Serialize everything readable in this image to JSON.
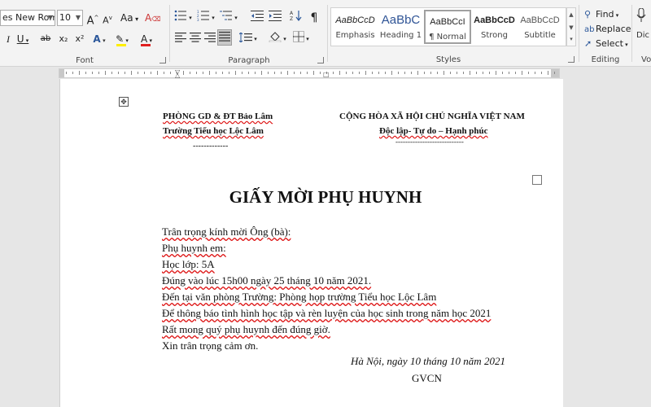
{
  "ribbon": {
    "font": {
      "label": "Font",
      "font_name": "es New Roma",
      "font_size": "10",
      "grow_label": "A",
      "shrink_label": "A",
      "case_label": "Aa",
      "clear_label": "A",
      "italic_label": "I",
      "underline_label": "U",
      "strike_label": "ab",
      "subscript_label": "x₂",
      "superscript_label": "x²",
      "effects_label": "A",
      "highlight_label": "✎",
      "color_label": "A",
      "color_accent": "#e02020",
      "highlight_accent": "#ffee00"
    },
    "paragraph": {
      "label": "Paragraph",
      "pilcrow": "¶"
    },
    "styles": {
      "label": "Styles",
      "items": [
        {
          "preview": "AaBbCcD",
          "name": "Emphasis"
        },
        {
          "preview": "AaBbC",
          "name": "Heading 1"
        },
        {
          "preview": "AaBbCcI",
          "name": "¶ Normal"
        },
        {
          "preview": "AaBbCcD",
          "name": "Strong"
        },
        {
          "preview": "AaBbCcD",
          "name": "Subtitle"
        }
      ],
      "heading_color": "#2f5496"
    },
    "editing": {
      "label": "Editing",
      "find": "Find",
      "replace": "Replace",
      "select": "Select"
    },
    "cut_off": {
      "dictate": "Dic",
      "voice": "Vo"
    }
  },
  "document": {
    "header_left_1": "PHÒNG GD & ĐT Bảo Lâm",
    "header_left_2": "Trường Tiểu học Lộc Lâm",
    "header_left_dash": "-------------",
    "header_right_1": "CỘNG HÒA XÃ HỘI CHỦ NGHĨA VIỆT NAM",
    "header_right_2": "Độc lập- Tự do – Hạnh phúc",
    "header_right_dash": "----------------------------",
    "title": "GIẤY MỜI PHỤ HUYNH",
    "lines": [
      "Trân trọng kính mời Ông (bà):",
      "Phụ huynh em:",
      "Học lớp: 5A",
      "Đúng vào lúc 15h00 ngày 25 tháng 10 năm 2021.",
      "Đến tại văn phòng Trường: Phòng họp trường Tiểu học Lộc Lâm",
      "Để thông báo tình hình học tập và rèn luyện của học sinh trong năm học 2021",
      "Rất mong quý phụ huynh đến đúng giờ.",
      "Xin trân trọng cảm ơn."
    ],
    "place_date": "Hà Nội, ngày 10 tháng 10  năm 2021",
    "signer": "GVCN"
  }
}
